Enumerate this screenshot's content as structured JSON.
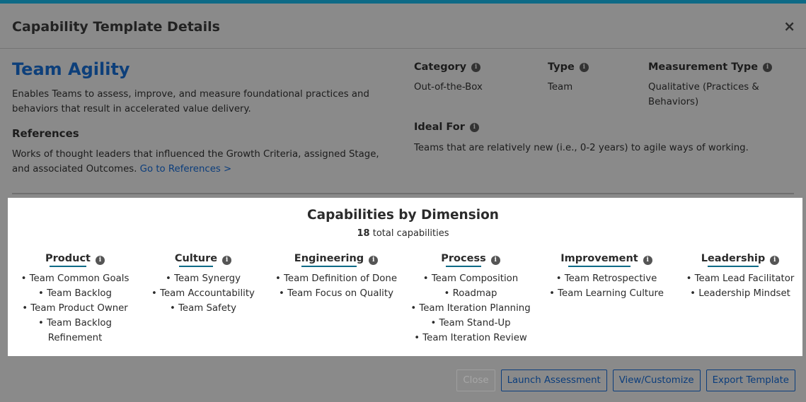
{
  "modal": {
    "title": "Capability Template Details"
  },
  "capability": {
    "name": "Team Agility",
    "description": "Enables Teams to assess, improve, and measure foundational practices and behaviors that result in accelerated value delivery."
  },
  "references": {
    "heading": "References",
    "text": "Works of thought leaders that influenced the Growth Criteria, assigned Stage, and associated Outcomes.",
    "link": "Go to References >"
  },
  "meta": {
    "category_label": "Category",
    "category_value": "Out-of-the-Box",
    "type_label": "Type",
    "type_value": "Team",
    "measurement_label": "Measurement Type",
    "measurement_value": "Qualitative (Practices & Behaviors)",
    "ideal_label": "Ideal For",
    "ideal_value": "Teams that are relatively new (i.e., 0-2 years) to agile ways of working."
  },
  "dimensions": {
    "title": "Capabilities by Dimension",
    "total_count": "18",
    "total_suffix": "total capabilities",
    "columns": [
      {
        "name": "Product",
        "items": [
          "• Team Common Goals",
          "• Team Backlog",
          "• Team Product Owner",
          "• Team Backlog Refinement"
        ]
      },
      {
        "name": "Culture",
        "items": [
          "• Team Synergy",
          "• Team Accountability",
          "• Team Safety"
        ]
      },
      {
        "name": "Engineering",
        "items": [
          "• Team Definition of Done",
          "• Team Focus on Quality"
        ]
      },
      {
        "name": "Process",
        "items": [
          "• Team Composition",
          "• Roadmap",
          "• Team Iteration Planning",
          "• Team Stand-Up",
          "• Team Iteration Review"
        ]
      },
      {
        "name": "Improvement",
        "items": [
          "• Team Retrospective",
          "• Team Learning Culture"
        ]
      },
      {
        "name": "Leadership",
        "items": [
          "• Team Lead Facilitator",
          "• Leadership Mindset"
        ]
      }
    ]
  },
  "buttons": {
    "close": "Close",
    "launch": "Launch Assessment",
    "view": "View/Customize",
    "export": "Export Template"
  },
  "icons": {
    "close": "×",
    "info": "i"
  },
  "colors": {
    "accent": "#0d3f7a",
    "underline": "#0d6a86"
  }
}
